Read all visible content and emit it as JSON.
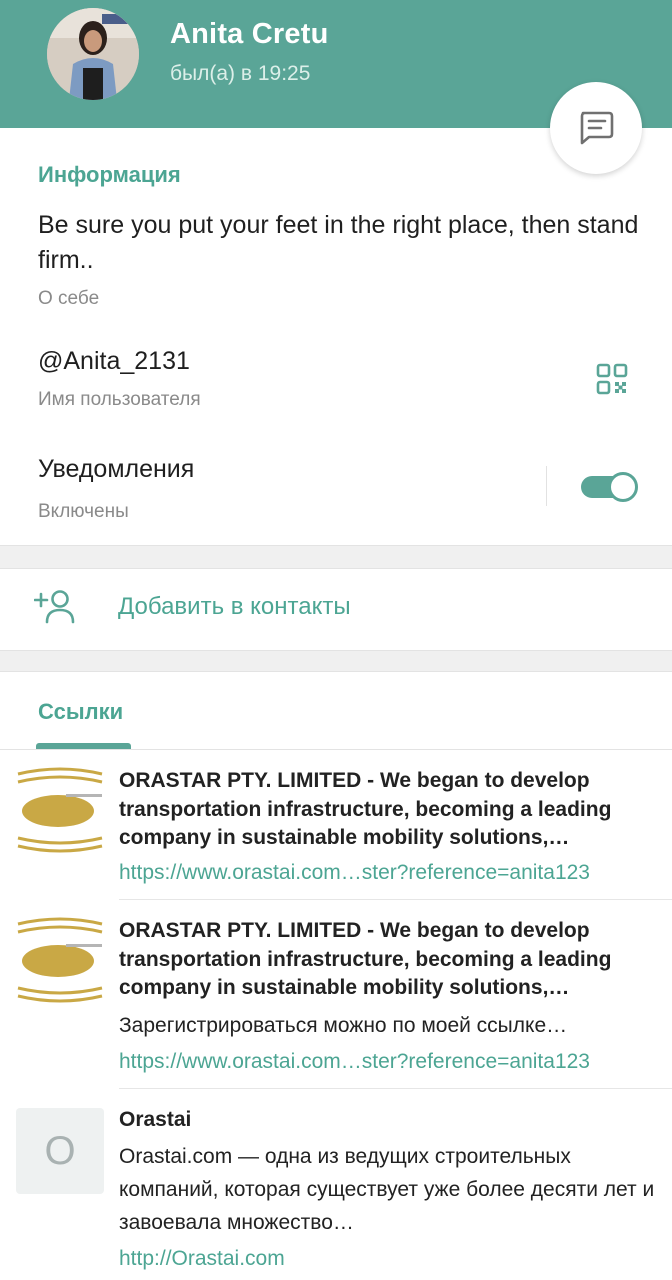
{
  "header": {
    "name": "Anita Cretu",
    "status": "был(а) в 19:25"
  },
  "info": {
    "section_title": "Информация",
    "bio": "Be sure you put your feet in the right place, then stand firm..",
    "bio_label": "О себе",
    "username": "@Anita_2131",
    "username_label": "Имя пользователя",
    "notifications": "Уведомления",
    "notifications_state": "Включены",
    "notifications_enabled": true
  },
  "actions": {
    "add_contact": "Добавить в контакты"
  },
  "links_tab": {
    "title": "Ссылки"
  },
  "links": [
    {
      "title": "ORASTAR PTY. LIMITED - We began to develop transportation infrastructure, becoming a leading company in sustainable mobility solutions,…",
      "url": "https://www.orastai.com…ster?reference=anita123"
    },
    {
      "title": "ORASTAR PTY. LIMITED - We began to develop transportation infrastructure, becoming a leading company in sustainable mobility solutions,…",
      "desc": "Зарегистрироваться можно по моей ссылке…",
      "url": "https://www.orastai.com…ster?reference=anita123"
    },
    {
      "thumb_letter": "O",
      "title": "Orastai",
      "desc": "Orastai.com — одна из ведущих строительных компаний, которая существует уже более десяти лет и завоевала множество…",
      "url": "http://Orastai.com"
    }
  ],
  "colors": {
    "accent": "#5aa597",
    "accent_text": "#4ca593",
    "logo_gold": "#c9a845"
  }
}
